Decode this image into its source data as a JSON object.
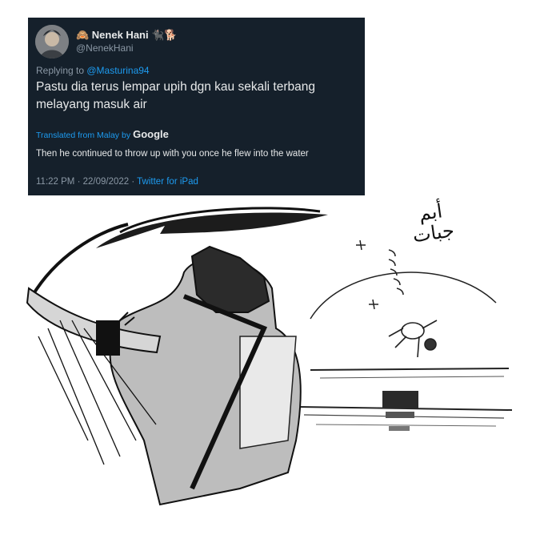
{
  "tweet": {
    "display_name": "🙈 Nenek Hani 🐈‍⬛🐕",
    "handle": "@NenekHani",
    "replying_prefix": "Replying to ",
    "replying_to": "@Masturina94",
    "text": "Pastu dia terus lempar upih dgn kau sekali terbang melayang masuk air",
    "translated_label": "Translated from Malay by",
    "translator": "Google",
    "translation": "Then he continued to throw up with you once he flew into the water",
    "time": "11:22 PM · 22/09/2022 · ",
    "source": "Twitter for iPad"
  },
  "comic": {
    "sound_effect": "أبم جبات"
  },
  "colors": {
    "tweet_bg": "#15202b",
    "link": "#1d9bf0",
    "muted": "#8b98a5"
  }
}
